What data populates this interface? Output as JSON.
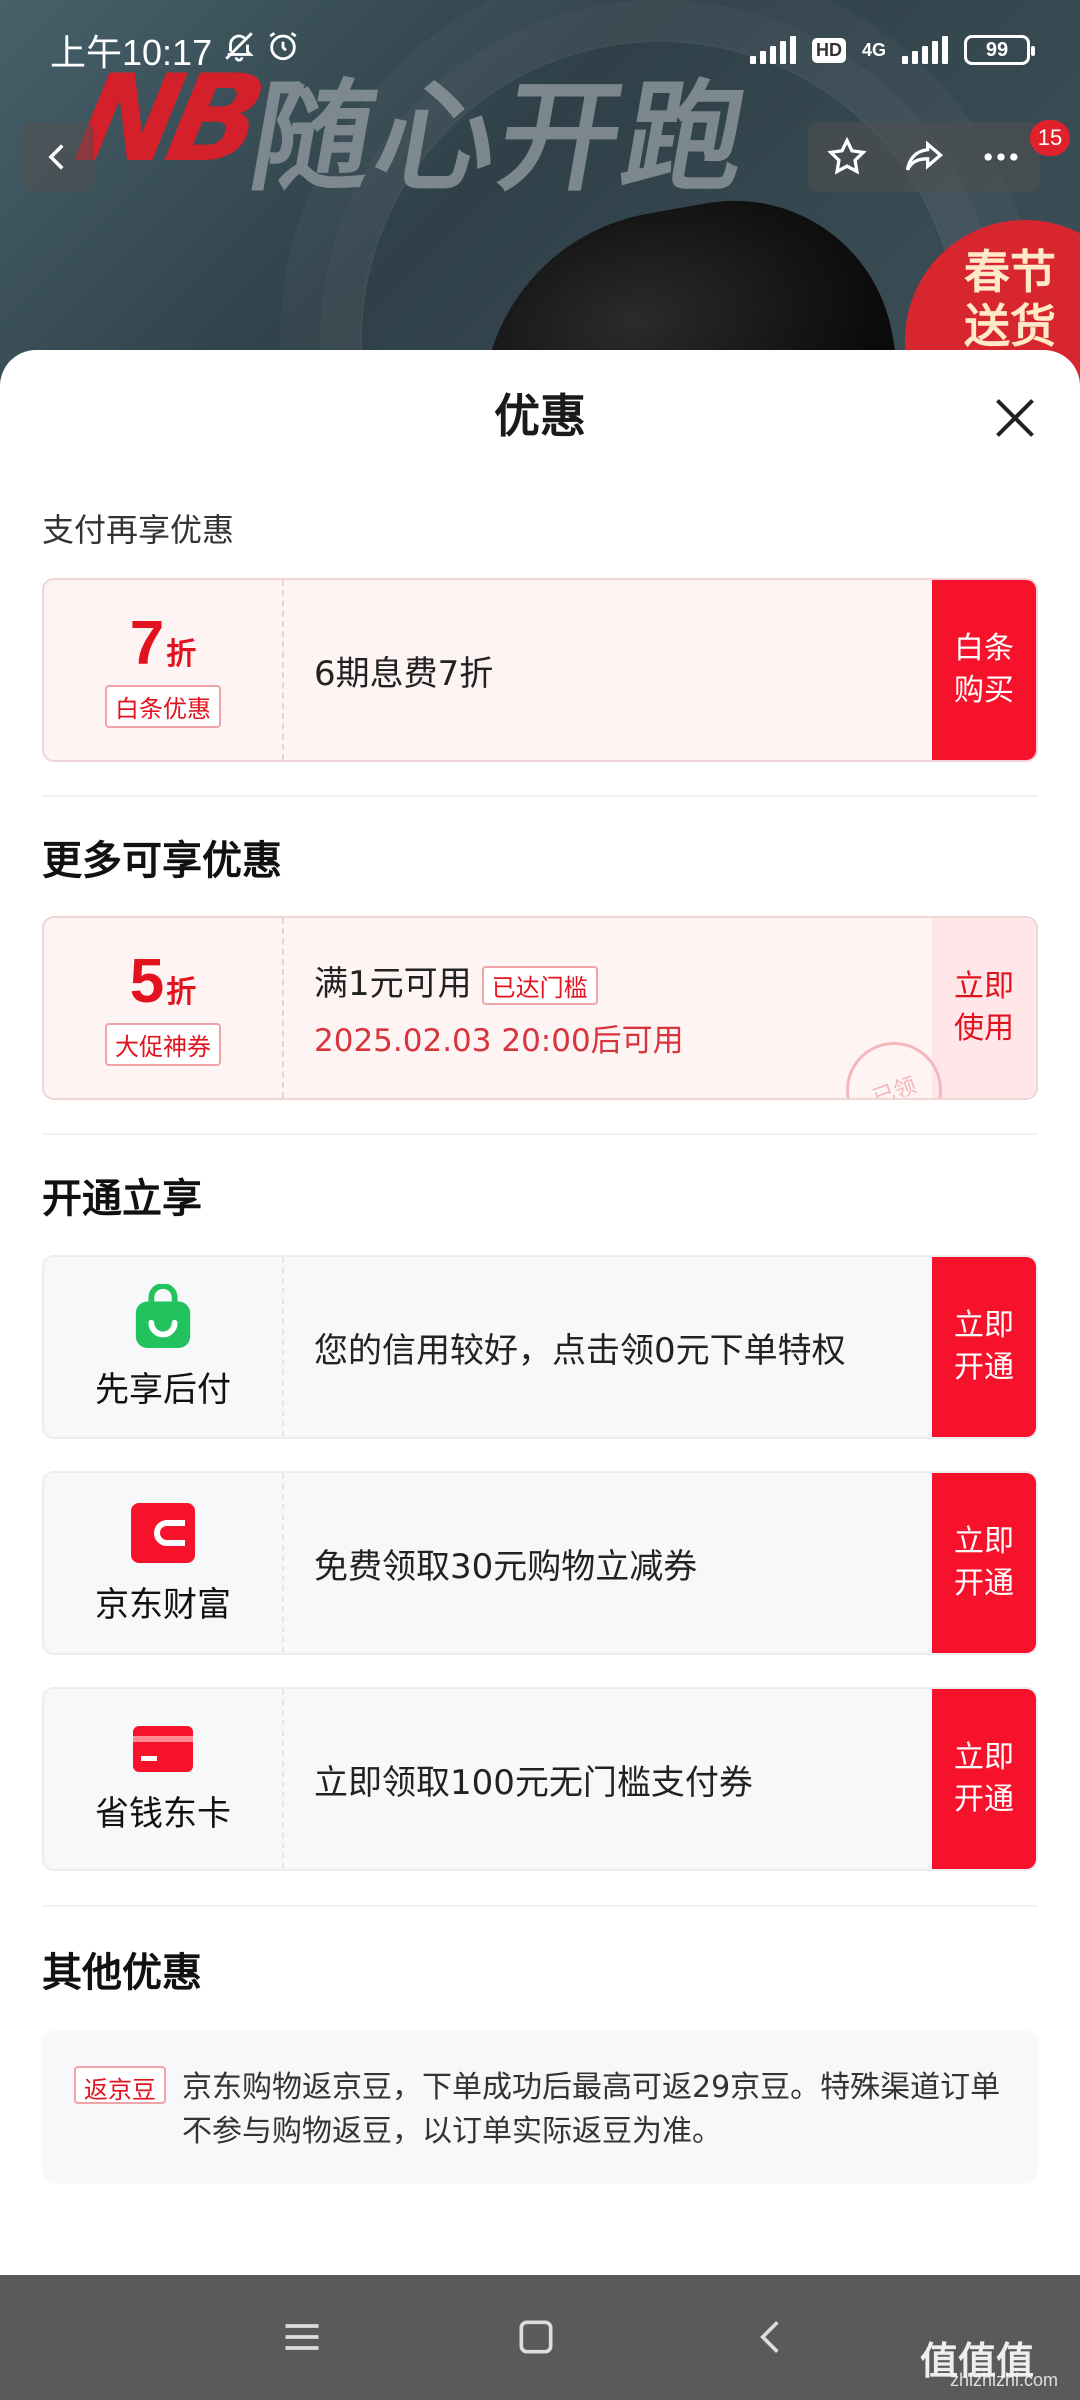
{
  "status_bar": {
    "time": "上午10:17",
    "battery": "99",
    "hd": "HD",
    "network": "4G"
  },
  "background": {
    "logo": "NB",
    "slogan": "随心开跑",
    "badge_text": "春节送货"
  },
  "nav": {
    "badge_count": "15"
  },
  "sheet": {
    "title": "优惠",
    "pay_section": {
      "label": "支付再享优惠",
      "card": {
        "discount_num": "7",
        "discount_unit": "折",
        "tag": "白条优惠",
        "desc": "6期息费7折",
        "button": "白条购买"
      }
    },
    "more_section": {
      "heading": "更多可享优惠",
      "card": {
        "discount_num": "5",
        "discount_unit": "折",
        "tag": "大促神券",
        "line1": "满1元可用",
        "status_tag": "已达门槛",
        "line2": "2025.02.03 20:00后可用",
        "button": "立即使用",
        "stamp": "已领"
      }
    },
    "open_section": {
      "heading": "开通立享",
      "items": [
        {
          "name": "先享后付",
          "desc": "您的信用较好，点击领0元下单特权",
          "button": "立即开通"
        },
        {
          "name": "京东财富",
          "desc": "免费领取30元购物立减券",
          "button": "立即开通"
        },
        {
          "name": "省钱东卡",
          "desc": "立即领取100元无门槛支付券",
          "button": "立即开通"
        }
      ]
    },
    "other_section": {
      "heading": "其他优惠",
      "tag": "返京豆",
      "text": "京东购物返京豆，下单成功后最高可返29京豆。特殊渠道订单不参与购物返豆，以订单实际返豆为准。"
    }
  },
  "watermark": {
    "main": "值值值",
    "sub": "zhizhizhi.com"
  },
  "colors": {
    "accent": "#f5122a",
    "card_pink": "#fff4f4",
    "card_grey": "#f7f8fa",
    "green": "#22c35e"
  }
}
